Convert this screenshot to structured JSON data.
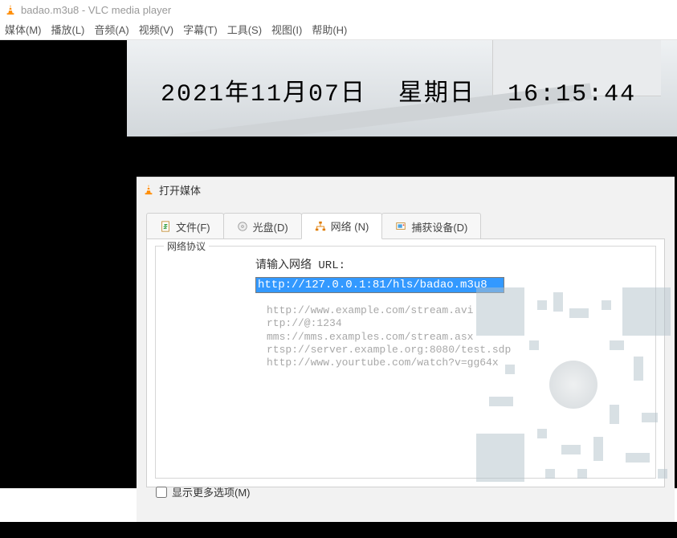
{
  "window": {
    "title": "badao.m3u8 - VLC media player"
  },
  "menu": {
    "media": "媒体(M)",
    "playback": "播放(L)",
    "audio": "音频(A)",
    "video": "视频(V)",
    "subtitle": "字幕(T)",
    "tools": "工具(S)",
    "view": "视图(I)",
    "help": "帮助(H)"
  },
  "overlay": {
    "date": "2021年11月07日",
    "weekday": "星期日",
    "time": "16:15:44"
  },
  "dialog": {
    "title": "打开媒体",
    "tabs": {
      "file": "文件(F)",
      "disc": "光盘(D)",
      "network": "网络 (N)",
      "capture": "捕获设备(D)"
    },
    "network": {
      "legend": "网络协议",
      "prompt": "请输入网络 URL:",
      "url": "http://127.0.0.1:81/hls/badao.m3u8",
      "examples": "http://www.example.com/stream.avi\nrtp://@:1234\nmms://mms.examples.com/stream.asx\nrtsp://server.example.org:8080/test.sdp\nhttp://www.yourtube.com/watch?v=gg64x"
    },
    "more_options": "显示更多选项(M)"
  }
}
